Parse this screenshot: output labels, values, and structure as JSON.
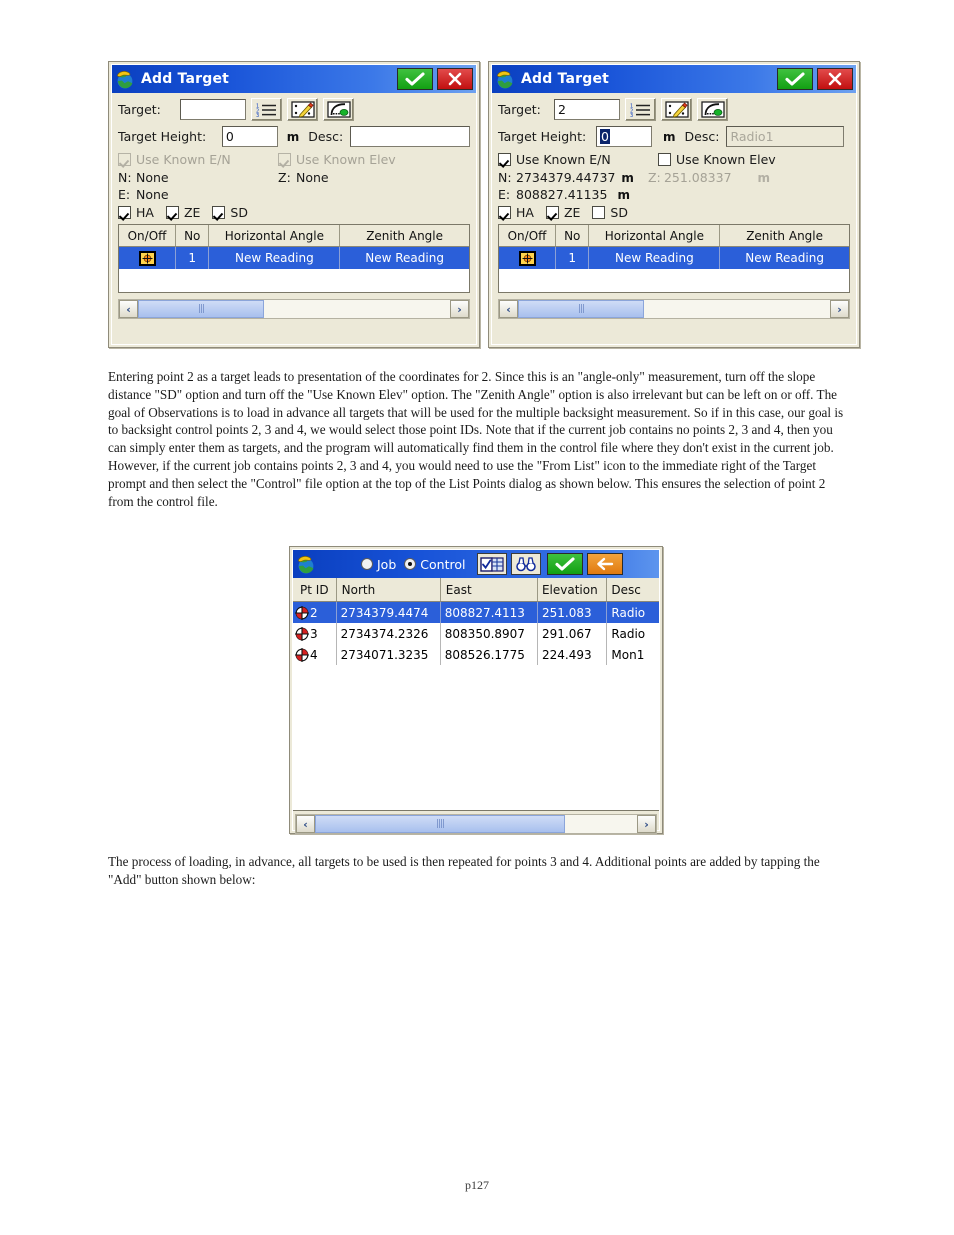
{
  "document": {
    "paragraph_1": "Entering point 2 as a target leads to presentation of the coordinates for 2.  Since this is an \"angle-only\" measurement, turn off the slope distance \"SD\" option and turn off the \"Use Known Elev\" option.  The \"Zenith Angle\" option is also irrelevant but can be left on or off.  The goal of Observations is to load in advance all targets that will be used for the multiple backsight measurement.  So if in this case, our goal is to backsight control points 2, 3 and 4, we would select those point IDs.  Note that if the current job contains no points 2, 3 and 4, then you can simply enter them as targets, and the program will automatically find them in the control file where they don't exist in the current job.  However, if the current job contains points 2, 3 and 4, you would need to use the \"From List\" icon to the immediate right of the Target prompt and then select the \"Control\" file option at the top of the List Points dialog as shown below.  This ensures the selection of point 2 from the control file.",
    "paragraph_2": "The process of loading, in advance, all targets to be used is then repeated for points 3 and 4.  Additional points are added by tapping the \"Add\" button shown below:",
    "page_number": "p127"
  },
  "colors": {
    "titlebar_blue": "#0a3fbf",
    "ok_green": "#13a013",
    "cancel_red": "#c10f0f",
    "back_orange": "#e07a10",
    "selection_blue": "#2b5fd9",
    "dialog_face": "#ece9d8"
  },
  "dialog_left": {
    "title": "Add Target",
    "app_icon": "survce-globe-icon",
    "ok_label": "✓",
    "close_label": "✕",
    "target_label": "Target:",
    "target_value": "",
    "icons": [
      "from-list-icon",
      "map-edit-icon",
      "total-station-icon"
    ],
    "target_height_label": "Target Height:",
    "target_height_value": "0",
    "unit": "m",
    "desc_label": "Desc:",
    "desc_value": "",
    "use_known_en_label": "Use Known E/N",
    "use_known_en_checked": true,
    "use_known_en_enabled": false,
    "use_known_elev_label": "Use Known Elev",
    "use_known_elev_checked": true,
    "use_known_elev_enabled": false,
    "n_label": "N:",
    "n_value": "None",
    "e_label": "E:",
    "e_value": "None",
    "z_label": "Z:",
    "z_value": "None",
    "ha_label": "HA",
    "ha_checked": true,
    "ze_label": "ZE",
    "ze_checked": true,
    "sd_label": "SD",
    "sd_checked": true,
    "grid_headers": [
      "On/Off",
      "No",
      "Horizontal Angle",
      "Zenith Angle"
    ],
    "grid_rows": [
      {
        "onoff": "target-toggle-icon",
        "no": "1",
        "horizontal_angle": "New Reading",
        "zenith_angle": "New Reading",
        "selected": true
      }
    ],
    "scroll_left": "‹",
    "scroll_right": "›"
  },
  "dialog_right": {
    "title": "Add Target",
    "app_icon": "survce-globe-icon",
    "ok_label": "✓",
    "close_label": "✕",
    "target_label": "Target:",
    "target_value": "2",
    "icons": [
      "from-list-icon",
      "map-edit-icon",
      "total-station-icon"
    ],
    "target_height_label": "Target Height:",
    "target_height_value": "0",
    "target_height_selected": true,
    "unit": "m",
    "desc_label": "Desc:",
    "desc_value": "Radio1",
    "desc_readonly": true,
    "use_known_en_label": "Use Known E/N",
    "use_known_en_checked": true,
    "use_known_en_enabled": true,
    "use_known_elev_label": "Use Known Elev",
    "use_known_elev_checked": false,
    "use_known_elev_enabled": true,
    "n_label": "N:",
    "n_value": "2734379.44737",
    "e_label": "E:",
    "e_value": "808827.41135",
    "z_label": "Z:",
    "z_value": "251.08337",
    "z_disabled": true,
    "ha_label": "HA",
    "ha_checked": true,
    "ze_label": "ZE",
    "ze_checked": true,
    "sd_label": "SD",
    "sd_checked": false,
    "grid_headers": [
      "On/Off",
      "No",
      "Horizontal Angle",
      "Zenith Angle"
    ],
    "grid_rows": [
      {
        "onoff": "target-toggle-icon",
        "no": "1",
        "horizontal_angle": "New Reading",
        "zenith_angle": "New Reading",
        "selected": true
      }
    ],
    "scroll_left": "‹",
    "scroll_right": "›"
  },
  "dialog_list": {
    "app_icon": "survce-globe-icon",
    "job_label": "Job",
    "job_selected": false,
    "control_label": "Control",
    "control_selected": true,
    "icons": [
      "select-list-icon",
      "binoculars-find-icon"
    ],
    "ok_label": "✓",
    "back_label": "←",
    "headers": [
      "Pt ID",
      "North",
      "East",
      "Elevation",
      "Desc"
    ],
    "rows": [
      {
        "icon": "control-point-icon",
        "pt_id": "2",
        "north": "2734379.4474",
        "east": "808827.4113",
        "elevation": "251.083",
        "desc": "Radio",
        "selected": true
      },
      {
        "icon": "control-point-icon",
        "pt_id": "3",
        "north": "2734374.2326",
        "east": "808350.8907",
        "elevation": "291.067",
        "desc": "Radio",
        "selected": false
      },
      {
        "icon": "control-point-icon",
        "pt_id": "4",
        "north": "2734071.3235",
        "east": "808526.1775",
        "elevation": "224.493",
        "desc": "Mon1",
        "selected": false
      }
    ],
    "scroll_left": "‹",
    "scroll_right": "›"
  }
}
